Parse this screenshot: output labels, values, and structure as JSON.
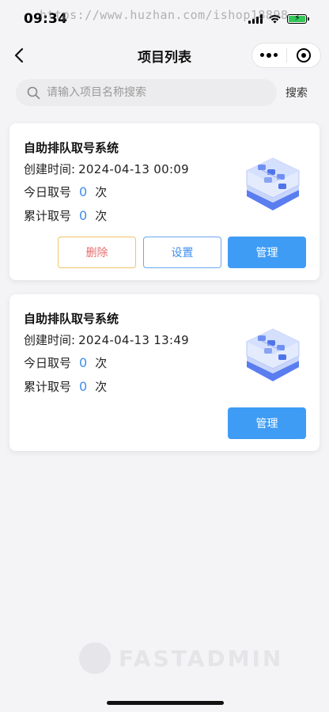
{
  "status": {
    "time": "09:34",
    "watermark": "https://www.huzhan.com/ishop18898"
  },
  "nav": {
    "title": "项目列表"
  },
  "search": {
    "placeholder": "请输入项目名称搜索",
    "button_label": "搜索"
  },
  "projects": [
    {
      "name": "自助排队取号系统",
      "created_label": "创建时间:",
      "created_time": "2024-04-13 00:09",
      "today_label": "今日取号",
      "today_count": "0",
      "today_unit": "次",
      "total_label": "累计取号",
      "total_count": "0",
      "total_unit": "次",
      "buttons": {
        "delete": "删除",
        "settings": "设置",
        "manage": "管理"
      }
    },
    {
      "name": "自助排队取号系统",
      "created_label": "创建时间:",
      "created_time": "2024-04-13 13:49",
      "today_label": "今日取号",
      "today_count": "0",
      "today_unit": "次",
      "total_label": "累计取号",
      "total_count": "0",
      "total_unit": "次",
      "buttons": {
        "manage": "管理"
      }
    }
  ],
  "footer": {
    "brand": "FASTADMIN"
  },
  "colors": {
    "accent": "#3f9cf5",
    "count": "#3f8ef0",
    "delete_border": "#f0c36a",
    "delete_text": "#e66e6e"
  },
  "icons": [
    "back-chevron-icon",
    "more-dots-icon",
    "target-circle-icon",
    "search-icon",
    "server-cube-icon"
  ]
}
